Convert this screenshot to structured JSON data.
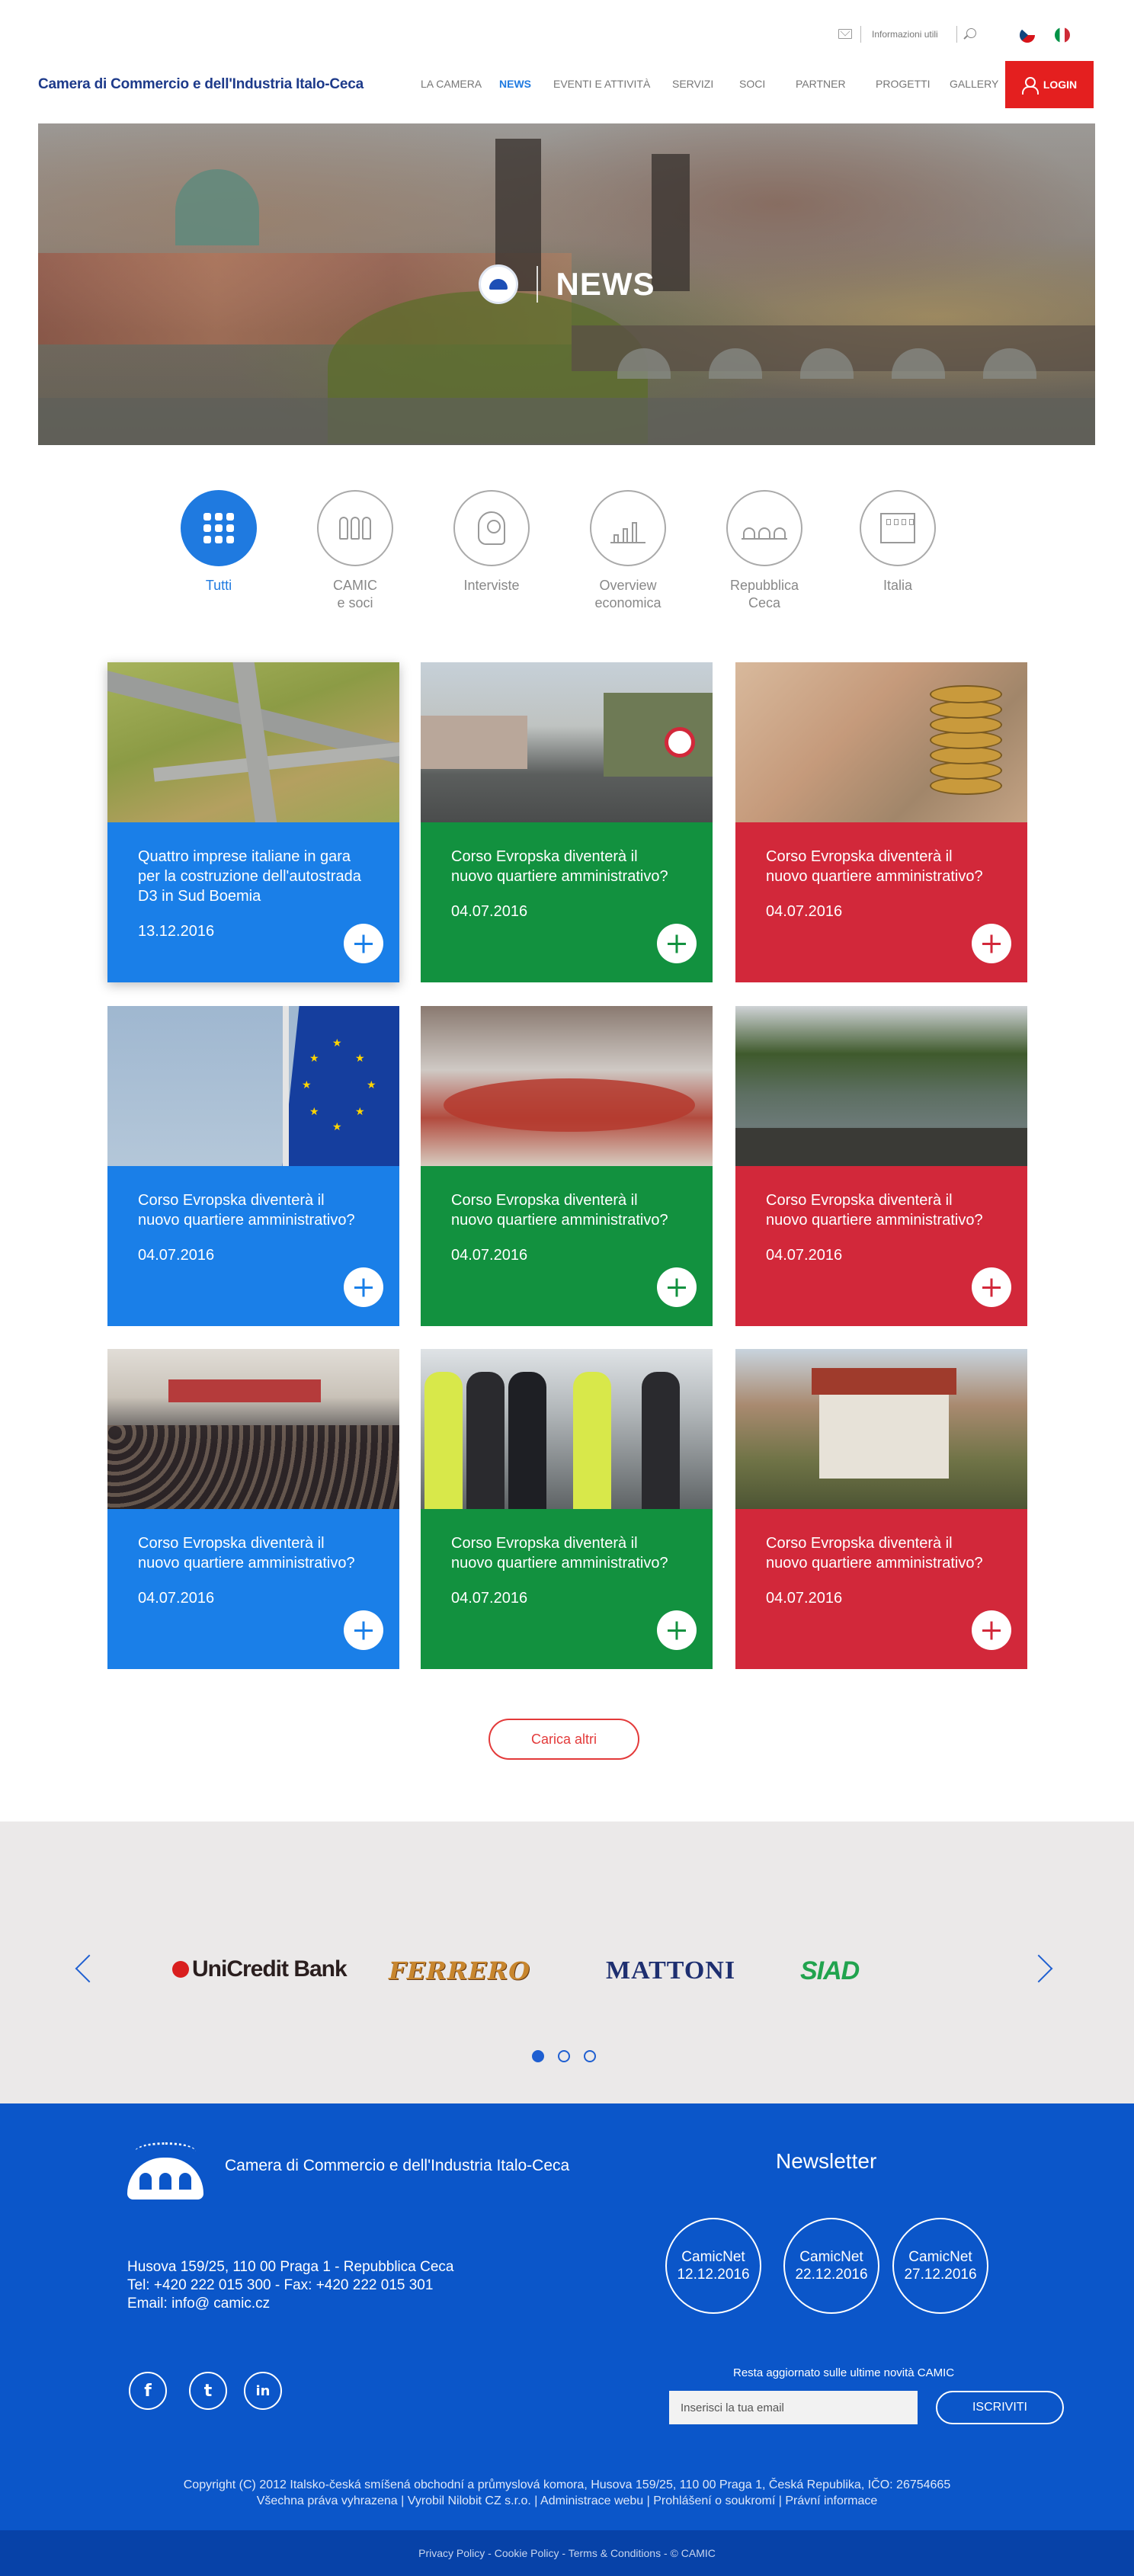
{
  "topbar": {
    "info_label": "Informazioni utili"
  },
  "header": {
    "brand": "Camera di Commercio e dell'Industria Italo-Ceca",
    "nav": [
      "LA CAMERA",
      "NEWS",
      "EVENTI E ATTIVITÀ",
      "SERVIZI",
      "SOCI",
      "PARTNER",
      "PROGETTI",
      "GALLERY"
    ],
    "active_nav": "NEWS",
    "login_label": "LOGIN"
  },
  "hero": {
    "title": "NEWS"
  },
  "categories": [
    {
      "label": "Tutti",
      "icon": "grid-icon",
      "active": true
    },
    {
      "label": "CAMIC\ne soci",
      "icon": "people-icon",
      "active": false
    },
    {
      "label": "Interviste",
      "icon": "head-icon",
      "active": false
    },
    {
      "label": "Overview\neconomica",
      "icon": "chart-icon",
      "active": false
    },
    {
      "label": "Repubblica\nCeca",
      "icon": "bridge-icon",
      "active": false
    },
    {
      "label": "Italia",
      "icon": "building-icon",
      "active": false
    }
  ],
  "cards": [
    {
      "title": "Quattro imprese italiane in gara per la costruzione dell'autostrada D3 in Sud Boemia",
      "date": "13.12.2016",
      "color": "#1a7fe8"
    },
    {
      "title": "Corso Evropska diventerà il nuovo quartiere amministrativo?",
      "date": "04.07.2016",
      "color": "#12913f"
    },
    {
      "title": "Corso Evropska diventerà il nuovo quartiere amministrativo?",
      "date": "04.07.2016",
      "color": "#d2283a"
    },
    {
      "title": "Corso Evropska diventerà il nuovo quartiere amministrativo?",
      "date": "04.07.2016",
      "color": "#1a7fe8"
    },
    {
      "title": "Corso Evropska diventerà il nuovo quartiere amministrativo?",
      "date": "04.07.2016",
      "color": "#12913f"
    },
    {
      "title": "Corso Evropska diventerà il nuovo quartiere amministrativo?",
      "date": "04.07.2016",
      "color": "#d2283a"
    },
    {
      "title": "Corso Evropska diventerà il nuovo quartiere amministrativo?",
      "date": "04.07.2016",
      "color": "#1a7fe8"
    },
    {
      "title": "Corso Evropska diventerà il nuovo quartiere amministrativo?",
      "date": "04.07.2016",
      "color": "#12913f"
    },
    {
      "title": "Corso Evropska diventerà il nuovo quartiere amministrativo?",
      "date": "04.07.2016",
      "color": "#d2283a"
    }
  ],
  "load_more_label": "Carica altri",
  "partners": {
    "logos": [
      "UniCredit Bank",
      "FERRERO",
      "MATTONI",
      "SIAD"
    ],
    "active_page": 1,
    "pages": 3
  },
  "footer": {
    "name": "Camera di Commercio e dell'Industria Italo-Ceca",
    "address": "Husova 159/25, 110 00 Praga 1 - Repubblica Ceca",
    "phone": "Tel: +420 222 015 300 - Fax: +420 222 015 301",
    "email": "Email: info@ camic.cz",
    "newsletter_title": "Newsletter",
    "newsletters": [
      {
        "name": "CamicNet",
        "date": "12.12.2016"
      },
      {
        "name": "CamicNet",
        "date": "22.12.2016"
      },
      {
        "name": "CamicNet",
        "date": "27.12.2016"
      }
    ],
    "subscribe_text": "Resta aggiornato sulle ultime novità CAMIC",
    "email_placeholder": "Inserisci la tua email",
    "subscribe_button": "ISCRIVITI",
    "copyright_line1": "Copyright (C) 2012 Italsko-česká smíšená obchodní a průmyslová komora, Husova 159/25, 110 00 Praga 1, Česká Republika, IČO: 26754665",
    "copyright_line2": "Všechna práva vyhrazena | Vyrobil Nilobit CZ s.r.o. | Administrace webu | Prohlášení o soukromí | Právní informace",
    "bottom_links": "Privacy Policy - Cookie Policy - Terms & Conditions - © CAMIC"
  }
}
